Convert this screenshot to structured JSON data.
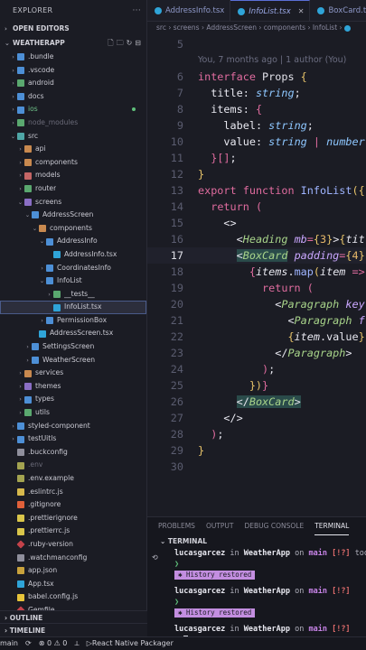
{
  "sidebar": {
    "title": "EXPLORER",
    "more": "···",
    "open_editors": "OPEN EDITORS",
    "project": "WEATHERAPP",
    "tree": [
      {
        "label": ".bundle",
        "depth": 1,
        "kind": "folder",
        "chev": "›",
        "color": "blue"
      },
      {
        "label": ".vscode",
        "depth": 1,
        "kind": "folder",
        "chev": "›",
        "color": "blue"
      },
      {
        "label": "android",
        "depth": 1,
        "kind": "folder",
        "chev": "›",
        "color": "green"
      },
      {
        "label": "docs",
        "depth": 1,
        "kind": "folder",
        "chev": "›",
        "color": "blue"
      },
      {
        "label": "ios",
        "depth": 1,
        "kind": "folder",
        "chev": "›",
        "color": "blue",
        "style": "green",
        "modified": true
      },
      {
        "label": "node_modules",
        "depth": 1,
        "kind": "folder",
        "chev": "›",
        "color": "green",
        "style": "dim"
      },
      {
        "label": "src",
        "depth": 1,
        "kind": "folder",
        "chev": "⌄",
        "color": "teal"
      },
      {
        "label": "api",
        "depth": 2,
        "kind": "folder",
        "chev": "›",
        "color": "orange"
      },
      {
        "label": "components",
        "depth": 2,
        "kind": "folder",
        "chev": "›",
        "color": "orange"
      },
      {
        "label": "models",
        "depth": 2,
        "kind": "folder",
        "chev": "›",
        "color": "red"
      },
      {
        "label": "router",
        "depth": 2,
        "kind": "folder",
        "chev": "›",
        "color": "green"
      },
      {
        "label": "screens",
        "depth": 2,
        "kind": "folder",
        "chev": "⌄",
        "color": "purple"
      },
      {
        "label": "AddressScreen",
        "depth": 3,
        "kind": "folder",
        "chev": "⌄",
        "color": "blue"
      },
      {
        "label": "components",
        "depth": 4,
        "kind": "folder",
        "chev": "⌄",
        "color": "orange"
      },
      {
        "label": "AddressInfo",
        "depth": 5,
        "kind": "folder",
        "chev": "⌄",
        "color": "blue"
      },
      {
        "label": "AddressInfo.tsx",
        "depth": 6,
        "kind": "tsx",
        "chev": ""
      },
      {
        "label": "CoordinatesInfo",
        "depth": 5,
        "kind": "folder",
        "chev": "›",
        "color": "blue"
      },
      {
        "label": "InfoList",
        "depth": 5,
        "kind": "folder",
        "chev": "⌄",
        "color": "blue"
      },
      {
        "label": "__tests__",
        "depth": 6,
        "kind": "folder",
        "chev": "›",
        "color": "green"
      },
      {
        "label": "InfoList.tsx",
        "depth": 6,
        "kind": "tsx",
        "chev": "",
        "selected": true
      },
      {
        "label": "PermissionBox",
        "depth": 5,
        "kind": "folder",
        "chev": "›",
        "color": "blue"
      },
      {
        "label": "AddressScreen.tsx",
        "depth": 4,
        "kind": "tsx",
        "chev": ""
      },
      {
        "label": "SettingsScreen",
        "depth": 3,
        "kind": "folder",
        "chev": "›",
        "color": "blue"
      },
      {
        "label": "WeatherScreen",
        "depth": 3,
        "kind": "folder",
        "chev": "›",
        "color": "blue"
      },
      {
        "label": "services",
        "depth": 2,
        "kind": "folder",
        "chev": "›",
        "color": "orange"
      },
      {
        "label": "themes",
        "depth": 2,
        "kind": "folder",
        "chev": "›",
        "color": "purple"
      },
      {
        "label": "types",
        "depth": 2,
        "kind": "folder",
        "chev": "›",
        "color": "blue"
      },
      {
        "label": "utils",
        "depth": 2,
        "kind": "folder",
        "chev": "›",
        "color": "green"
      },
      {
        "label": "styled-component",
        "depth": 1,
        "kind": "folder",
        "chev": "›",
        "color": "blue"
      },
      {
        "label": "testUitls",
        "depth": 1,
        "kind": "folder",
        "chev": "›",
        "color": "blue"
      },
      {
        "label": ".buckconfig",
        "depth": 1,
        "kind": "gear",
        "chev": ""
      },
      {
        "label": ".env",
        "depth": 1,
        "kind": "env",
        "chev": "",
        "style": "dim"
      },
      {
        "label": ".env.example",
        "depth": 1,
        "kind": "env",
        "chev": ""
      },
      {
        "label": ".eslintrc.js",
        "depth": 1,
        "kind": "js",
        "chev": ""
      },
      {
        "label": ".gitignore",
        "depth": 1,
        "kind": "git",
        "chev": ""
      },
      {
        "label": ".prettierignore",
        "depth": 1,
        "kind": "bang",
        "chev": ""
      },
      {
        "label": ".prettierrc.js",
        "depth": 1,
        "kind": "bang",
        "chev": ""
      },
      {
        "label": ".ruby-version",
        "depth": 1,
        "kind": "ruby",
        "chev": ""
      },
      {
        "label": ".watchmanconfig",
        "depth": 1,
        "kind": "gear",
        "chev": ""
      },
      {
        "label": "app.json",
        "depth": 1,
        "kind": "json",
        "chev": ""
      },
      {
        "label": "App.tsx",
        "depth": 1,
        "kind": "tsx",
        "chev": ""
      },
      {
        "label": "babel.config.js",
        "depth": 1,
        "kind": "babel",
        "chev": ""
      },
      {
        "label": "Gemfile",
        "depth": 1,
        "kind": "ruby",
        "chev": ""
      }
    ],
    "outline": "OUTLINE",
    "timeline": "TIMELINE"
  },
  "tabs": [
    {
      "label": "AddressInfo.tsx",
      "active": false
    },
    {
      "label": "InfoList.tsx",
      "active": true
    },
    {
      "label": "BoxCard.tsx",
      "active": false
    }
  ],
  "breadcrumb": "src › screens › AddressScreen › components › InfoList › ",
  "editor": {
    "blame": "You, 7 months ago | 1 author (You)",
    "current_line": 17,
    "lines": [
      {
        "n": "5",
        "html": ""
      },
      {
        "n": "",
        "html": "__BLAME__"
      },
      {
        "n": "6",
        "html": "<span class='kw'>interface</span> <span class='ty'>Props</span> <span class='br'>{</span>"
      },
      {
        "n": "7",
        "html": "  <span class='pr'>title</span><span class='pu'>:</span> <span class='ity'>string</span><span class='pu'>;</span>"
      },
      {
        "n": "8",
        "html": "  <span class='pr'>items</span><span class='pu'>:</span> <span class='kw'>{</span>"
      },
      {
        "n": "9",
        "html": "    <span class='pr'>label</span><span class='pu'>:</span> <span class='ity'>string</span><span class='pu'>;</span>"
      },
      {
        "n": "10",
        "html": "    <span class='pr'>value</span><span class='pu'>:</span> <span class='ity'>string</span> <span class='kw'>|</span> <span class='ity'>number</span>"
      },
      {
        "n": "11",
        "html": "  <span class='kw'>}[]</span><span class='pu'>;</span>"
      },
      {
        "n": "12",
        "html": "<span class='br'>}</span>"
      },
      {
        "n": "13",
        "html": "<span class='kw'>export</span> <span class='kw'>function</span> <span class='fn'>InfoList</span><span class='br'>({</span>"
      },
      {
        "n": "14",
        "html": "  <span class='kw'>return</span> <span class='kw'>(</span>"
      },
      {
        "n": "15",
        "html": "    <span class='pu'>&lt;&gt;</span>"
      },
      {
        "n": "16",
        "html": "      <span class='pu'>&lt;</span><span class='ta'>Heading</span> <span class='at'>mb</span><span class='kw'>=</span><span class='br'>{</span><span class='nu'>3</span><span class='br'>}</span><span class='pu'>&gt;</span><span class='br'>{</span><span class='va'>tit</span>"
      },
      {
        "n": "17",
        "html": "      <span class='bg-tag'><span class='pu'>&lt;</span><span class='ta'>BoxCard</span></span> <span class='at'>padding</span><span class='kw'>=</span><span class='br'>{</span><span class='nu'>4</span><span class='br'>}</span>"
      },
      {
        "n": "18",
        "html": "        <span class='kw'>{</span><span class='va'>items</span><span class='pu'>.</span><span class='fn'>map</span><span class='br'>(</span><span class='va'>item</span> <span class='kw'>=&gt;</span>"
      },
      {
        "n": "19",
        "html": "          <span class='kw'>return</span> <span class='kw'>(</span>"
      },
      {
        "n": "20",
        "html": "            <span class='pu'>&lt;</span><span class='ta'>Paragraph</span> <span class='at'>key</span>"
      },
      {
        "n": "21",
        "html": "              <span class='pu'>&lt;</span><span class='ta'>Paragraph</span> <span class='at'>f</span>"
      },
      {
        "n": "22",
        "html": "              <span class='br'>{</span><span class='va'>item</span><span class='pu'>.value</span><span class='br'>}</span>"
      },
      {
        "n": "23",
        "html": "            <span class='pu'>&lt;/</span><span class='ta'>Paragraph</span><span class='pu'>&gt;</span>"
      },
      {
        "n": "24",
        "html": "          <span class='kw'>)</span><span class='pu'>;</span>"
      },
      {
        "n": "25",
        "html": "        <span class='br'>})</span><span class='kw'>}</span>"
      },
      {
        "n": "26",
        "html": "      <span class='bg-tag'><span class='pu'>&lt;/</span><span class='ta'>BoxCard</span><span class='pu'>&gt;</span></span>"
      },
      {
        "n": "27",
        "html": "    <span class='pu'>&lt;/&gt;</span>"
      },
      {
        "n": "28",
        "html": "  <span class='kw'>)</span><span class='pu'>;</span>"
      },
      {
        "n": "29",
        "html": "<span class='br'>}</span>"
      },
      {
        "n": "30",
        "html": ""
      }
    ]
  },
  "panel": {
    "tabs": [
      "PROBLEMS",
      "OUTPUT",
      "DEBUG CONSOLE",
      "TERMINAL"
    ],
    "active_tab": "TERMINAL",
    "terminal_title": "TERMINAL",
    "user": "lucasgarcez",
    "in": "in",
    "app": "WeatherApp",
    "on": "on",
    "branch": " main",
    "flags": "[!?]",
    "took": "took",
    "prompt": "❯",
    "restored": "History restored"
  },
  "status": {
    "branch": "main",
    "sync": "⟳",
    "problems": "⊗ 0 ⚠ 0",
    "bell": "⟂",
    "packager": "React Native Packager"
  }
}
